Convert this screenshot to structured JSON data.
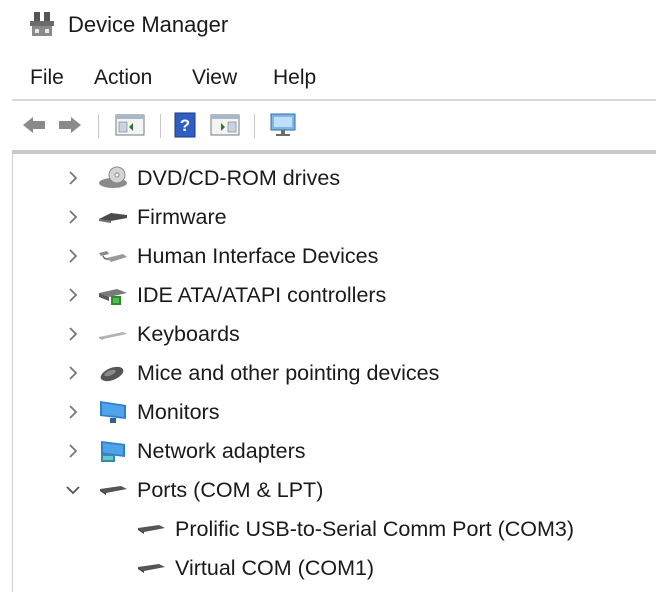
{
  "window": {
    "title": "Device Manager"
  },
  "menu": [
    "File",
    "Action",
    "View",
    "Help"
  ],
  "toolbar": [
    "back-icon",
    "forward-icon",
    "show-hide-console-tree-icon",
    "help-icon",
    "properties-panel-icon",
    "scan-hardware-icon"
  ],
  "tree": [
    {
      "label": "DVD/CD-ROM drives",
      "state": "collapsed",
      "icon": "dvd-drive-icon"
    },
    {
      "label": "Firmware",
      "state": "collapsed",
      "icon": "firmware-icon"
    },
    {
      "label": "Human Interface Devices",
      "state": "collapsed",
      "icon": "hid-icon"
    },
    {
      "label": "IDE ATA/ATAPI controllers",
      "state": "collapsed",
      "icon": "ide-controller-icon"
    },
    {
      "label": "Keyboards",
      "state": "collapsed",
      "icon": "keyboard-icon"
    },
    {
      "label": "Mice and other pointing devices",
      "state": "collapsed",
      "icon": "mouse-icon"
    },
    {
      "label": "Monitors",
      "state": "collapsed",
      "icon": "monitor-icon"
    },
    {
      "label": "Network adapters",
      "state": "collapsed",
      "icon": "network-adapter-icon"
    },
    {
      "label": "Ports (COM & LPT)",
      "state": "expanded",
      "icon": "port-icon",
      "children": [
        {
          "label": "Prolific USB-to-Serial Comm Port (COM3)",
          "icon": "port-icon"
        },
        {
          "label": "Virtual COM (COM1)",
          "icon": "port-icon"
        }
      ]
    }
  ]
}
